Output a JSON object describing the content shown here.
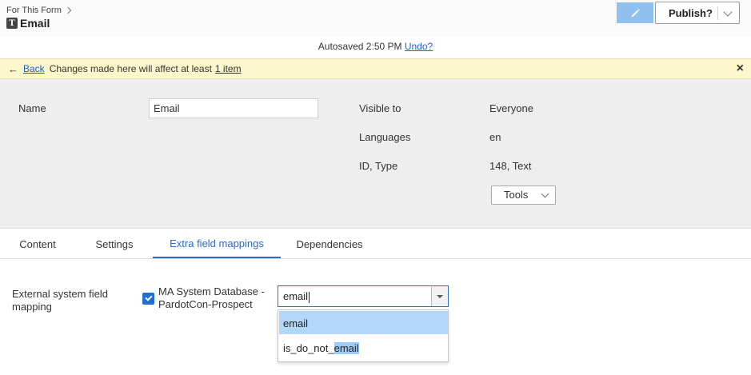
{
  "header": {
    "breadcrumb": "For This Form",
    "type_icon_letter": "T",
    "title": "Email",
    "publish_label": "Publish?"
  },
  "autosave": {
    "text": "Autosaved 2:50 PM",
    "undo_label": "Undo?"
  },
  "notice": {
    "back_label": "Back",
    "text": "Changes made here will affect at least",
    "link_label": "1 item",
    "close_glyph": "×"
  },
  "properties": {
    "name_label": "Name",
    "name_value": "Email",
    "visible_to_label": "Visible to",
    "visible_to_value": "Everyone",
    "languages_label": "Languages",
    "languages_value": "en",
    "id_type_label": "ID, Type",
    "id_type_value": "148, Text",
    "tools_label": "Tools"
  },
  "tabs": [
    {
      "label": "Content",
      "active": false
    },
    {
      "label": "Settings",
      "active": false
    },
    {
      "label": "Extra field mappings",
      "active": true
    },
    {
      "label": "Dependencies",
      "active": false
    }
  ],
  "mapping": {
    "section_label": "External system field mapping",
    "database_label": "MA System Database - PardotCon-Prospect",
    "checked": true,
    "input_value": "email",
    "options": [
      {
        "prefix": "",
        "match": "email",
        "highlighted": true
      },
      {
        "prefix": "is_do_not_",
        "match": "email",
        "highlighted": false
      }
    ]
  },
  "colors": {
    "accent": "#2a6ac9",
    "notice_bg": "#fcf8cc",
    "panel_bg": "#eeeeee",
    "option_highlight": "#b3d7fb",
    "edit_button": "#8fc0f0"
  },
  "icons": {
    "breadcrumb_chevron": "chevron-right-icon",
    "edit": "pencil-icon",
    "back": "arrow-left-icon",
    "close": "close-icon",
    "dropdown": "chevron-down-icon"
  }
}
